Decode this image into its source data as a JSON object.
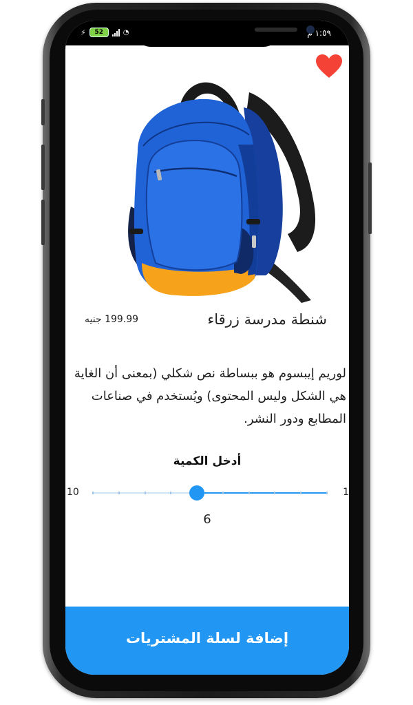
{
  "status_bar": {
    "time": "١:٥٩ م",
    "battery": "52"
  },
  "product": {
    "title": "شنطة مدرسة زرقاء",
    "price": "199.99 جنيه",
    "description": "لوريم إيبسوم هو ببساطة نص شكلي (بمعنى أن الغاية هي الشكل وليس المحتوى) ويُستخدم في صناعات المطابع ودور النشر.",
    "favorite": true,
    "image_icon": "blue-backpack-image"
  },
  "quantity": {
    "label": "أدخل الكمية",
    "min": 1,
    "max": 10,
    "value": 6,
    "min_label": "1",
    "max_label": "10",
    "value_label": "6"
  },
  "actions": {
    "add_to_cart": "إضافة لسلة المشتريات"
  },
  "colors": {
    "accent": "#2196f3",
    "heart": "#f44336",
    "bag_blue": "#1f63d6",
    "bag_orange": "#f7a21b"
  }
}
